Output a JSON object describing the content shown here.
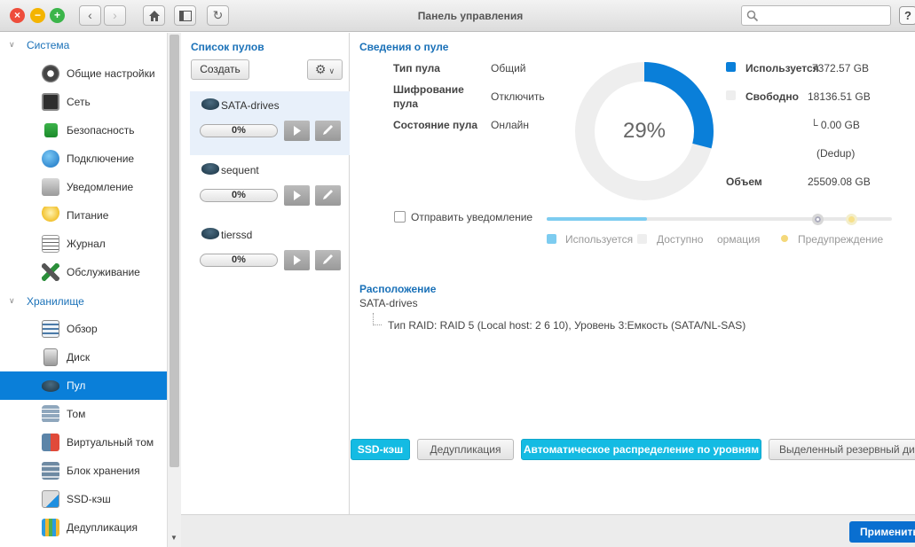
{
  "window": {
    "title": "Панель управления",
    "search_placeholder": "",
    "help_label": "?"
  },
  "sidebar": {
    "groups": [
      {
        "label": "Система"
      },
      {
        "label": "Хранилище"
      }
    ],
    "items": [
      {
        "label": "Общие настройки",
        "icon": "gear-icon"
      },
      {
        "label": "Сеть",
        "icon": "network-icon"
      },
      {
        "label": "Безопасность",
        "icon": "lock-icon"
      },
      {
        "label": "Подключение",
        "icon": "globe-icon"
      },
      {
        "label": "Уведомление",
        "icon": "bell-icon"
      },
      {
        "label": "Питание",
        "icon": "lightbulb-icon"
      },
      {
        "label": "Журнал",
        "icon": "log-icon"
      },
      {
        "label": "Обслуживание",
        "icon": "tools-icon"
      },
      {
        "label": "Обзор",
        "icon": "overview-icon"
      },
      {
        "label": "Диск",
        "icon": "disk-icon"
      },
      {
        "label": "Пул",
        "icon": "pool-icon"
      },
      {
        "label": "Том",
        "icon": "volume-icon"
      },
      {
        "label": "Виртуальный том",
        "icon": "virtual-volume-icon"
      },
      {
        "label": "Блок хранения",
        "icon": "storage-block-icon"
      },
      {
        "label": "SSD-кэш",
        "icon": "ssd-cache-icon"
      },
      {
        "label": "Дедупликация",
        "icon": "dedup-icon"
      }
    ]
  },
  "pools": {
    "heading": "Список пулов",
    "create_label": "Создать",
    "list": [
      {
        "name": "SATA-drives",
        "progress": "0%"
      },
      {
        "name": "sequent",
        "progress": "0%"
      },
      {
        "name": "tierssd",
        "progress": "0%"
      }
    ]
  },
  "info": {
    "heading": "Сведения о пуле",
    "type_label": "Тип пула",
    "type_value": "Общий",
    "enc_label_1": "Шифрование",
    "enc_label_2": "пула",
    "enc_value": "Отключить",
    "state_label": "Состояние пула",
    "state_value": "Онлайн"
  },
  "usage": {
    "percent_label": "29%",
    "percent": 29,
    "used_label": "Используется",
    "used_value": "7372.57 GB",
    "free_label": "Свободно",
    "free_value": "18136.51 GB",
    "dedup_value": "└ 0.00 GB",
    "dedup_label": "(Dedup)",
    "total_label": "Объем",
    "total_value": "25509.08 GB",
    "colors": {
      "used": "#0a7fd9",
      "free": "#eeeeee"
    }
  },
  "notify": {
    "label": "Отправить уведомление",
    "legend": [
      "Используется",
      "Доступно",
      "ормация",
      "Предупреждение"
    ],
    "level_used": 0.29
  },
  "location": {
    "heading": "Расположение",
    "pool_name": "SATA-drives",
    "raid_line": "Тип RAID: RAID 5 (Local host: 2 6 10), Уровень 3:Емкость (SATA/NL-SAS)"
  },
  "tabs": [
    {
      "label": "SSD-кэш",
      "active": true
    },
    {
      "label": "Дедупликация",
      "active": false
    },
    {
      "label": "Автоматическое распределение по уровням",
      "active": true
    },
    {
      "label": "Выделенный резервный ди",
      "active": false
    }
  ],
  "footer": {
    "apply_label": "Применить"
  }
}
